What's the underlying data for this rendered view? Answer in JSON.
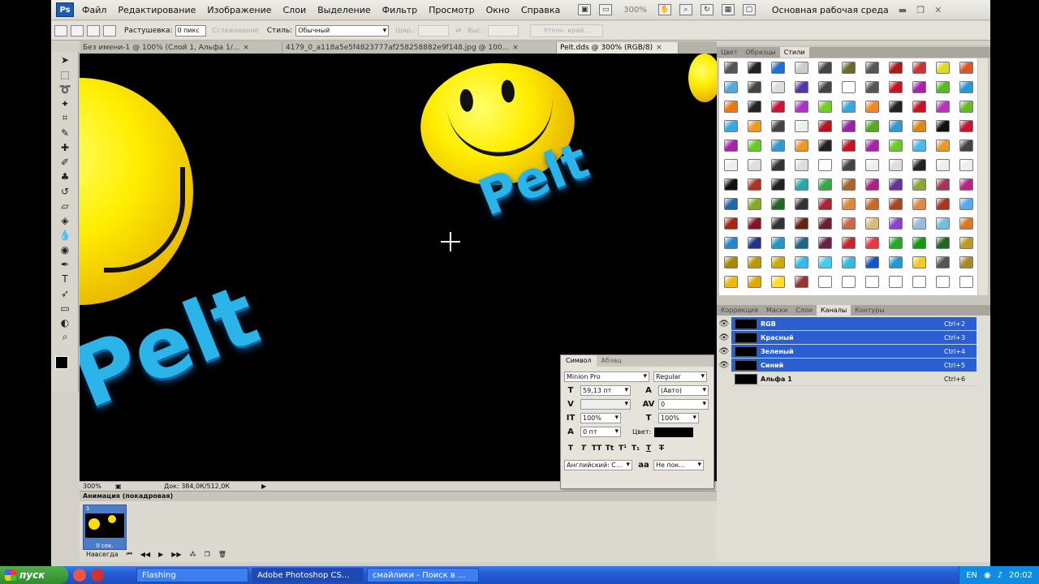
{
  "menubar": {
    "logo": "Ps",
    "items": [
      "Файл",
      "Редактирование",
      "Изображение",
      "Слои",
      "Выделение",
      "Фильтр",
      "Просмотр",
      "Окно",
      "Справка"
    ],
    "zoom": "300%",
    "workspace": "Основная рабочая среда"
  },
  "options": {
    "feather_label": "Растушевка:",
    "feather_value": "0 пикс",
    "antialias_label": "Сглаживание",
    "style_label": "Стиль:",
    "style_value": "Обычный",
    "width_label": "Шир.:",
    "height_label": "Выс.:",
    "refine_btn": "Уточн. край..."
  },
  "tabs": [
    {
      "label": "Без имени-1 @ 100% (Слой 1, Альфа 1/...",
      "active": false
    },
    {
      "label": "4179_0_a118a5e5f4823777af258258882e9f148.jpg @ 100...",
      "active": false
    },
    {
      "label": "Pelt.dds @ 300% (RGB/8)",
      "active": true
    }
  ],
  "canvas": {
    "word": "Pelt"
  },
  "status": {
    "zoom": "300%",
    "doc": "Док: 384,0К/512,0К"
  },
  "animation": {
    "title": "Анимация (покадровая)",
    "frame_num": "1",
    "frame_time": "0 сек.",
    "loop": "Навсегда"
  },
  "character": {
    "tabs": [
      "Символ",
      "Абзац"
    ],
    "font": "Minion Pro",
    "style": "Regular",
    "size": "59,13 пт",
    "leading": "(Авто)",
    "tracking": "0",
    "vscale": "100%",
    "hscale": "100%",
    "baseline": "0 пт",
    "color_label": "Цвет:",
    "language": "Английский: С...",
    "aa": "Не пок..."
  },
  "styles_panel": {
    "tabs": [
      "Цвет",
      "Образцы",
      "Стили"
    ],
    "swatches": [
      "#555",
      "#222",
      "#1a6fd0",
      "#ccc",
      "#444",
      "#6a6a2a",
      "#555",
      "#b01818",
      "#cc3333",
      "#dddd22",
      "#dd5522",
      "#55aadd",
      "#444",
      "#ddd",
      "#5533aa",
      "#444",
      "#fff",
      "#555",
      "#cc1122",
      "#aa22aa",
      "#55bb22",
      "#2299dd",
      "#ee7711",
      "#222",
      "#cc1133",
      "#aa33cc",
      "#77cc22",
      "#33aadd",
      "#ee8822",
      "#222",
      "#cc1122",
      "#bb33bb",
      "#66bb22",
      "#33aadd",
      "#ee9922",
      "#444",
      "#eee",
      "#bb1122",
      "#9922aa",
      "#55aa22",
      "#3399cc",
      "#dd8811",
      "#111",
      "#cc1133",
      "#aa22aa",
      "#66cc22",
      "#3399cc",
      "#ee9922",
      "#222",
      "#cc1122",
      "#aa22aa",
      "#66cc22",
      "#44bbee",
      "#ee9922",
      "#444",
      "#eee",
      "#ddd",
      "#333",
      "#ddd",
      "#fff",
      "#444",
      "#eee",
      "#ddd",
      "#222",
      "#eee",
      "#eee",
      "#111",
      "#aa3322",
      "#222",
      "#22aaaa",
      "#33aa44",
      "#aa6622",
      "#aa2288",
      "#663399",
      "#88aa33",
      "#aa3355",
      "#bb2288",
      "#2266aa",
      "#88aa22",
      "#226622",
      "#333",
      "#aa2233",
      "#dd8833",
      "#cc6622",
      "#aa4422",
      "#dd8844",
      "#aa3322",
      "#55aaee",
      "#aa2211",
      "#881122",
      "#333",
      "#662211",
      "#662233",
      "#cc6644",
      "#ddbb77",
      "#8844cc",
      "#99bbdd",
      "#77bbdd",
      "#dd7722",
      "#2288cc",
      "#223388",
      "#2299bb",
      "#226688",
      "#662244",
      "#cc2233",
      "#ee3344",
      "#22aa22",
      "#119911",
      "#226622",
      "#bb9922",
      "#aa8800",
      "#bb9900",
      "#ccaa00",
      "#33bbee",
      "#44ccee",
      "#33bbdd",
      "#1155cc",
      "#2299cc",
      "#eecc22",
      "#555",
      "#aa8822",
      "#eebb00",
      "#ddaa00",
      "#ffdd22",
      "#993333",
      "#fff",
      "#fff",
      "#fff",
      "#fff",
      "#fff",
      "#fff",
      "#fff"
    ]
  },
  "layers_panel": {
    "tabs": [
      "Коррекция",
      "Маски",
      "Слои",
      "Каналы",
      "Контуры"
    ],
    "channels": [
      {
        "name": "RGB",
        "key": "Ctrl+2",
        "sel": true
      },
      {
        "name": "Красный",
        "key": "Ctrl+3",
        "sel": true
      },
      {
        "name": "Зеленый",
        "key": "Ctrl+4",
        "sel": true
      },
      {
        "name": "Синий",
        "key": "Ctrl+5",
        "sel": true
      },
      {
        "name": "Альфа 1",
        "key": "Ctrl+6",
        "sel": false
      }
    ]
  },
  "taskbar": {
    "start": "пуск",
    "tasks": [
      "Flashing",
      "Adobe Photoshop CS...",
      "смайлики - Поиск в ..."
    ],
    "lang": "EN",
    "time": "20:02"
  }
}
